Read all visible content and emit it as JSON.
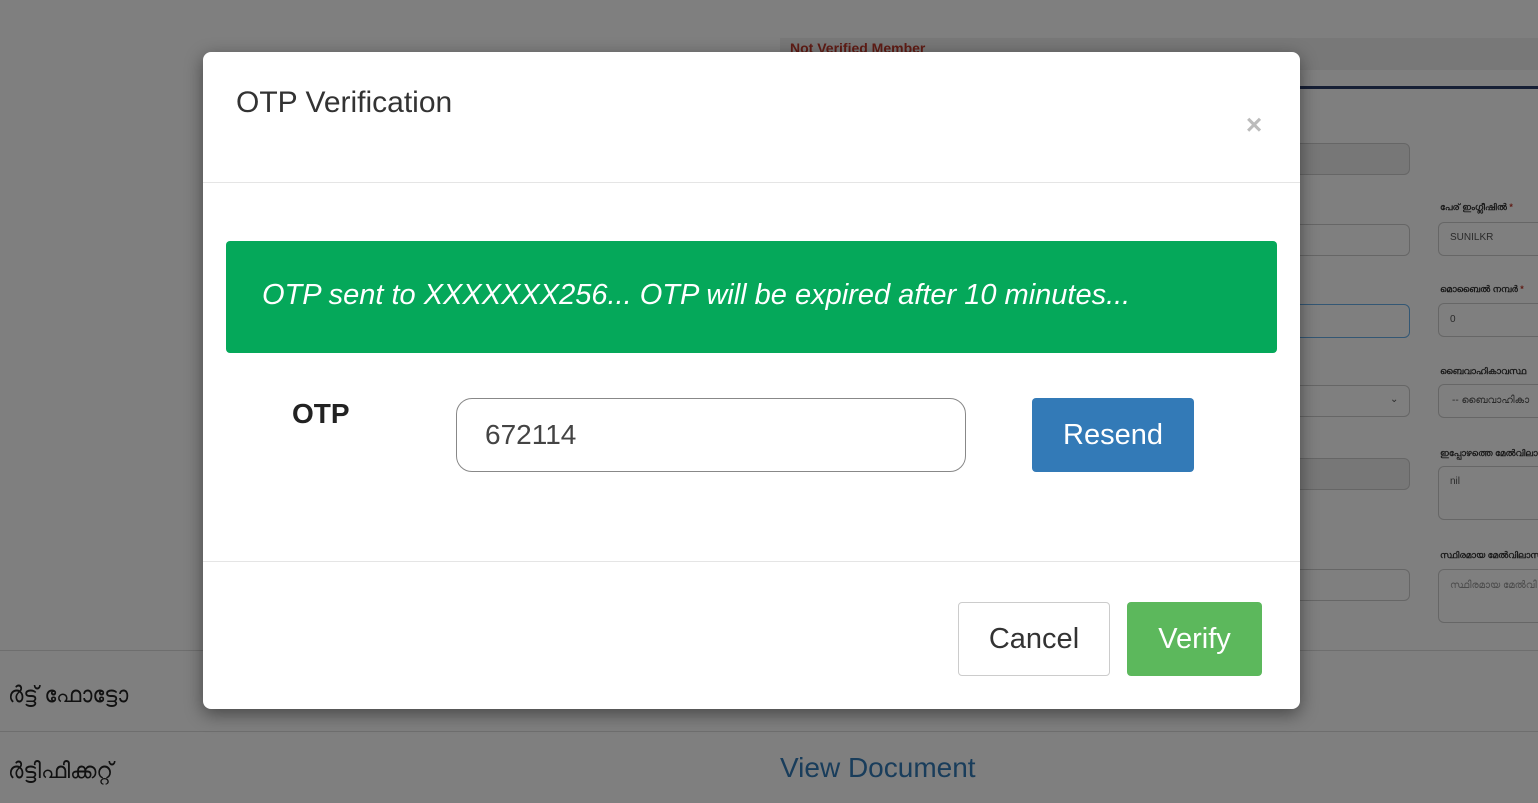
{
  "background": {
    "status_text": "Not Verified Member",
    "fields": [
      {
        "label": "പേര് ഇംഗ്ലീഷിൽ",
        "required": "*",
        "value": "SUNILKR"
      },
      {
        "label": "മൊബൈൽ നമ്പർ",
        "required": "*",
        "value": "0"
      },
      {
        "label": "ബൈവാഹികാവസ്ഥ",
        "required": "",
        "value": "-- ബൈവാഹികാ"
      },
      {
        "label": "ഇപ്പോഴത്തെ മേൽവിലാസം",
        "required": "",
        "value": "nil"
      },
      {
        "label": "സ്ഥിരമായ മേൽവിലാസം",
        "required": "",
        "value": "സ്ഥിരമായ മേൽവി"
      }
    ],
    "rows": [
      {
        "label": "ർട്ട് ഫോട്ടോ"
      },
      {
        "label": "ർട്ടിഫിക്കറ്റ്",
        "link": "View Document"
      }
    ]
  },
  "modal": {
    "title": "OTP Verification",
    "close_symbol": "×",
    "alert_text": "OTP sent to XXXXXXX256... OTP will be expired after 10 minutes...",
    "otp_label": "OTP",
    "otp_value": "672114",
    "resend_label": "Resend",
    "cancel_label": "Cancel",
    "verify_label": "Verify"
  },
  "colors": {
    "alert_success": "#05a85a",
    "primary": "#337ab7",
    "success": "#5cb85c",
    "link": "#337ab7"
  }
}
